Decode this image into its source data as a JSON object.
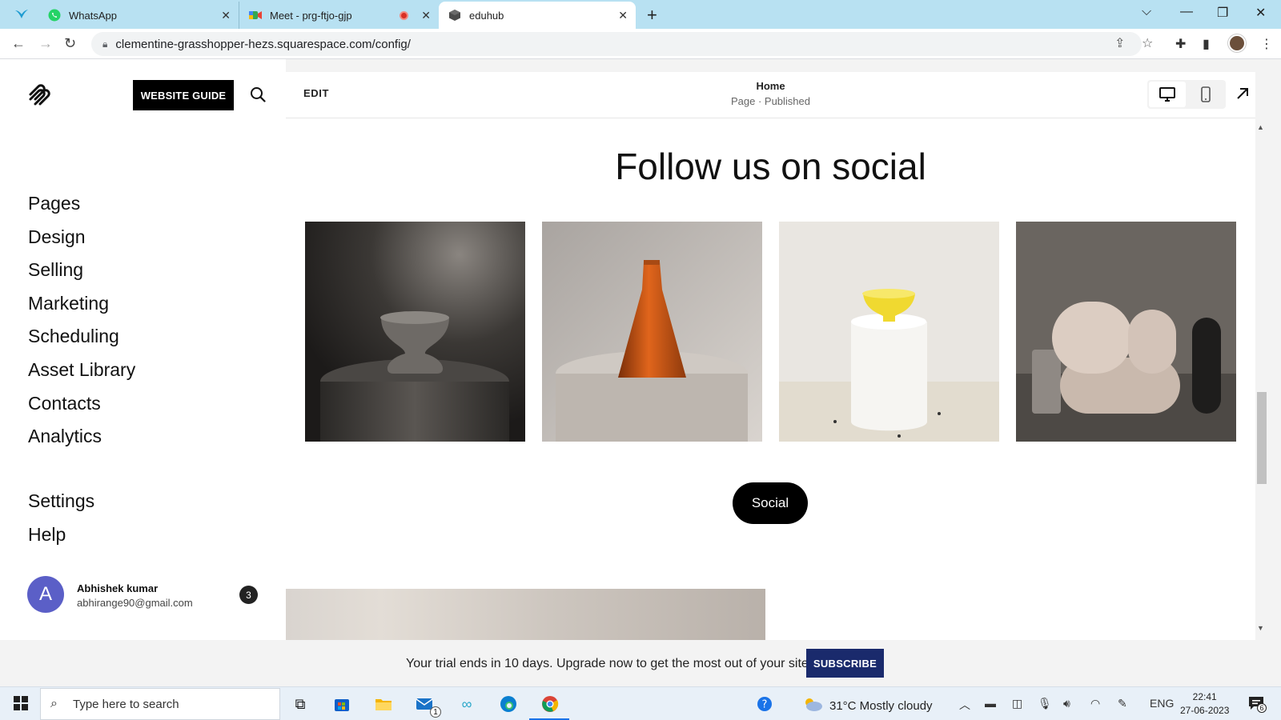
{
  "browser": {
    "tabs": [
      {
        "title": "WhatsApp"
      },
      {
        "title": "Meet - prg-ftjo-gjp"
      },
      {
        "title": "eduhub"
      }
    ],
    "url": "clementine-grasshopper-hezs.squarespace.com/config/"
  },
  "sidebar": {
    "guide_label": "WEBSITE GUIDE",
    "nav": [
      "Pages",
      "Design",
      "Selling",
      "Marketing",
      "Scheduling",
      "Asset Library",
      "Contacts",
      "Analytics"
    ],
    "nav2": [
      "Settings",
      "Help"
    ],
    "user": {
      "initial": "A",
      "name": "Abhishek kumar",
      "email": "abhirange90@gmail.com",
      "badge": "3"
    }
  },
  "editor": {
    "edit_label": "EDIT",
    "page_title": "Home",
    "page_status": "Page · Published",
    "section_title": "Follow us on social",
    "social_button": "Social"
  },
  "trial": {
    "text": "Your trial ends in 10 days. Upgrade now to get the most out of your site.",
    "subscribe_label": "SUBSCRIBE"
  },
  "taskbar": {
    "search_placeholder": "Type here to search",
    "mail_badge": "1",
    "weather": "31°C  Mostly cloudy",
    "lang": "ENG",
    "time": "22:41",
    "date": "27-06-2023",
    "notif_count": "6"
  }
}
